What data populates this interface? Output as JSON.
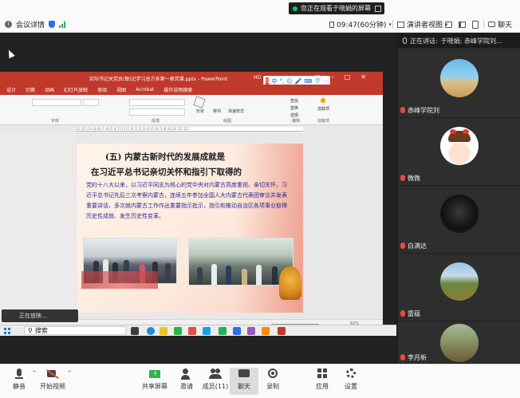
{
  "notice": {
    "text": "您正在观看于晓娟的屏幕"
  },
  "meeting_header": {
    "details_label": "会议详情",
    "clock": "09:47(60分钟)",
    "view_label": "演讲者视图",
    "chat_label": "聊天"
  },
  "ppt": {
    "title": "实际书记关党员(联)记学习总方系第一章党课.pptx - PowerPoint",
    "user_fragment": "HO",
    "tabs": [
      "设计",
      "切换",
      "动画",
      "幻灯片放映",
      "审阅",
      "视图",
      "Acrobat",
      "操作说明搜索"
    ],
    "ime_items": [
      "中",
      "°,",
      "☺",
      "🎤",
      "⌨",
      "👕",
      "⋯"
    ],
    "ribbon_groups": [
      "字体",
      "段落",
      "绘图",
      "编辑",
      "加载项"
    ],
    "ribbon_buttons": [
      "形状",
      "排列",
      "快速样式",
      "查找",
      "替换",
      "选择",
      "加载项"
    ],
    "ruler_text": "12 |11 |10 |9 |8 |7 |6 |5 |4 |3 |2 |1 |0 |1 |2 |3 |4 |5 |6 |7 |8 |9 |10 |11 |12",
    "zoom": "62%"
  },
  "slide": {
    "title_line1": "(五) 内蒙古新时代的发展成就是",
    "title_line2": "在习近平总书记亲切关怀和指引下取得的",
    "paragraph": "党的十八大以来，以习近平同志为核心的党中央对内蒙古高度重视、亲切关怀，习近平总书记先后三次考察内蒙古，连续五年参加全国人大内蒙古代表团审议并发表重要讲话，多次就内蒙古工作作出重要指示批示，指引和推动自治区各项事业取得历史性成就、发生历史性变革。"
  },
  "tooltip": {
    "text": "正在放映..."
  },
  "taskbar": {
    "search_label": "搜索"
  },
  "panel": {
    "speaking_prefix": "正在讲话:",
    "speaking_names": "于晓娟; 赤峰学院刘...",
    "participants": [
      {
        "name": "赤峰学院刘",
        "avatar": "beach-photo"
      },
      {
        "name": "微微",
        "avatar": "cartoon-girl"
      },
      {
        "name": "白满达",
        "avatar": "dark-figure"
      },
      {
        "name": "雷蕴",
        "avatar": "landscape"
      },
      {
        "name": "李月新",
        "avatar": "field-sign"
      }
    ]
  },
  "toolbar": {
    "mute": "静音",
    "video": "开始视频",
    "share": "共享屏幕",
    "invite": "邀请",
    "members": "成员(11)",
    "chat": "聊天",
    "record": "录制",
    "apps": "应用",
    "settings": "设置"
  },
  "colors": {
    "ppt_red": "#c0392b",
    "accent_blue": "#2a6ef0",
    "signal_green": "#29b24b",
    "slide_text_blue": "#2a2a9a"
  }
}
